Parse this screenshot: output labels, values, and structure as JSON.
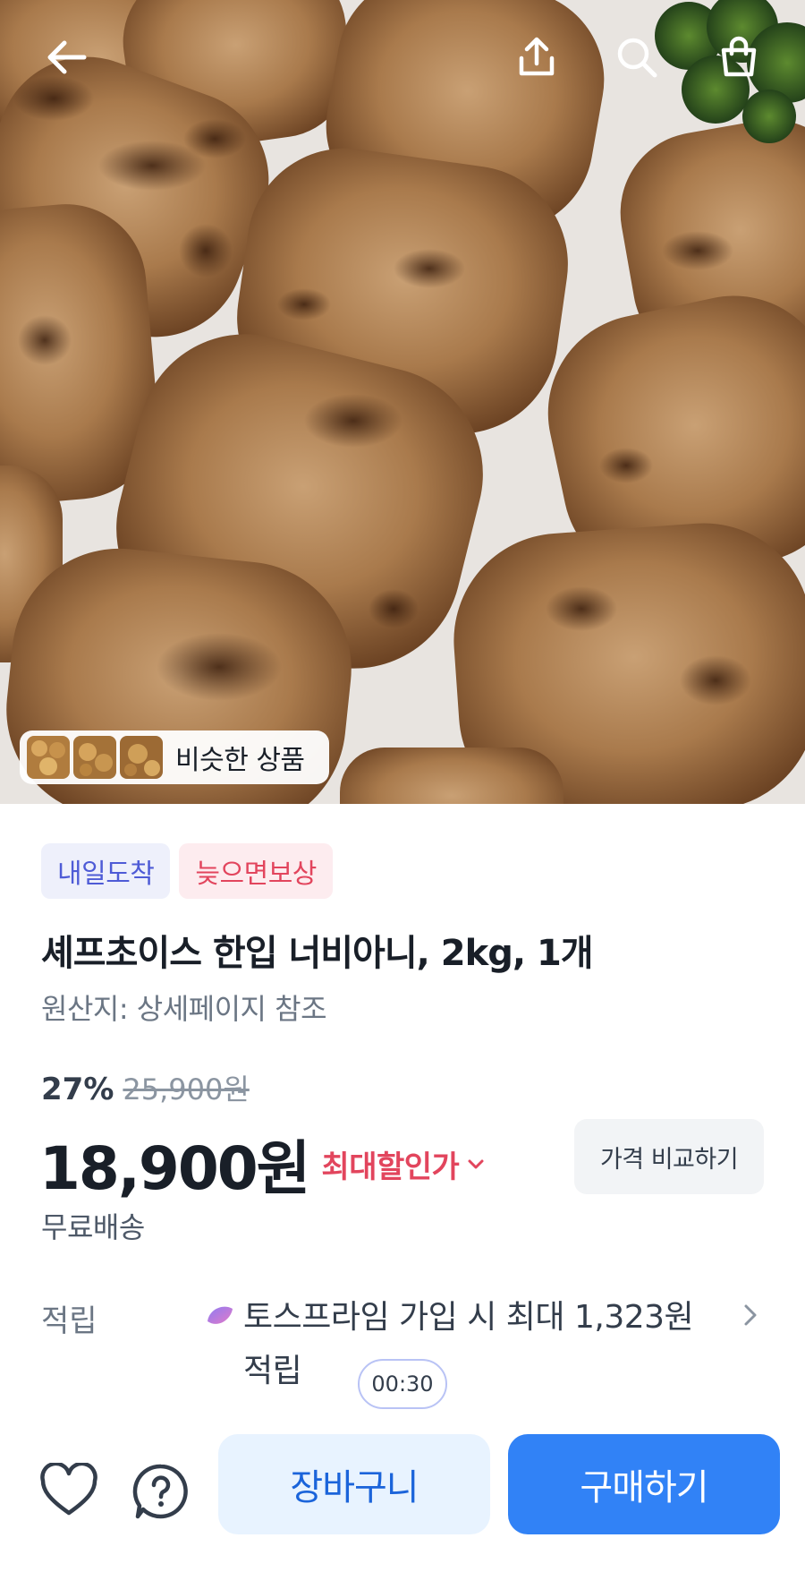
{
  "hero": {
    "similar_label": "비슷한 상품"
  },
  "icons": {
    "back": "back-arrow-icon",
    "share": "share-icon",
    "search": "search-icon",
    "cart": "shopping-bag-icon",
    "reward": "toss-prime-icon",
    "chevron": "chevron-right-icon",
    "heart": "heart-icon",
    "help": "question-icon"
  },
  "badges": {
    "arrival": "내일도착",
    "late_comp": "늦으면보상"
  },
  "product": {
    "title": "셰프초이스 한입 너비아니, 2kg, 1개",
    "origin": "원산지: 상세페이지 참조",
    "discount_rate": "27%",
    "original_price": "25,900원",
    "price": "18,900원",
    "max_discount": "최대할인가",
    "compare_label": "가격 비교하기",
    "shipping": "무료배송"
  },
  "reward": {
    "label": "적립",
    "text": "토스프라임 가입 시 최대 1,323원 적립",
    "timer": "00:30"
  },
  "actions": {
    "cart": "장바구니",
    "buy": "구매하기"
  },
  "colors": {
    "primary": "#3182f6",
    "primary_light": "#e8f3ff",
    "accent_red": "#e2455d",
    "badge_blue": "#4e5bd6"
  }
}
